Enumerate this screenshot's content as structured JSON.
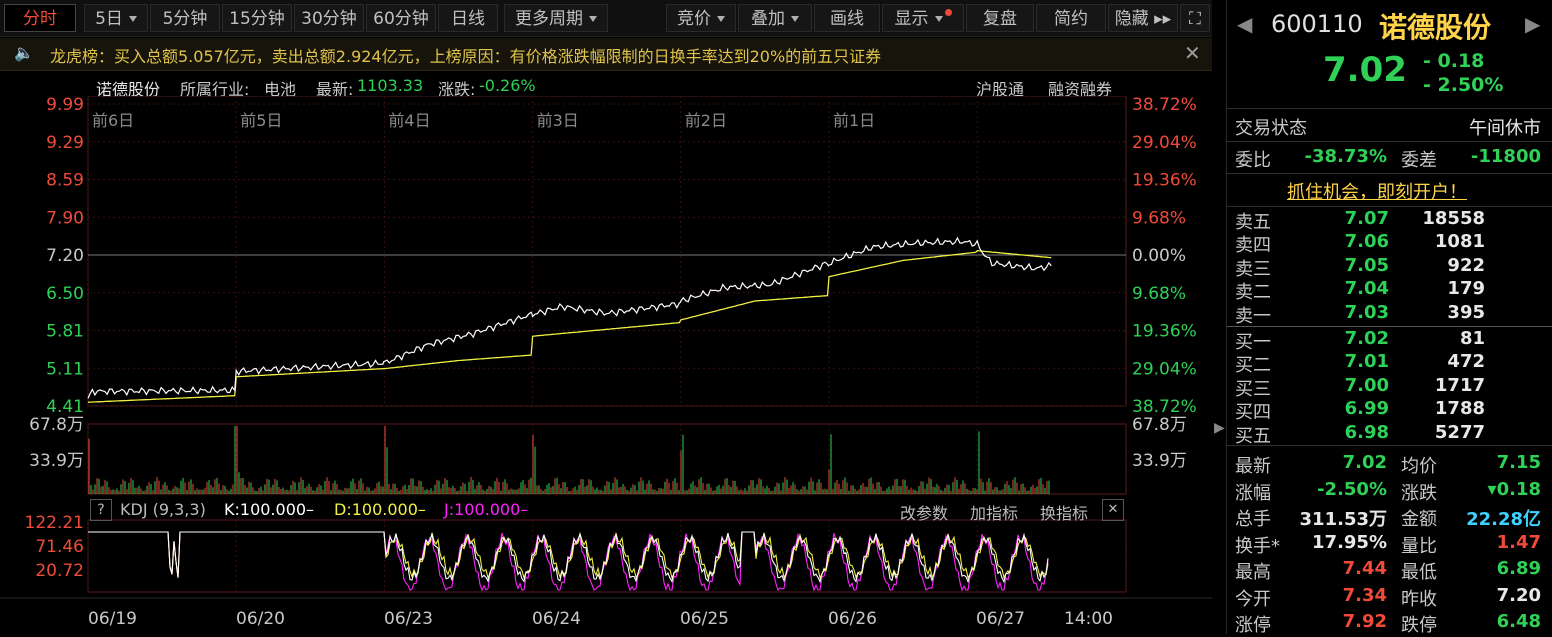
{
  "tabs": [
    {
      "label": "分时",
      "active": true,
      "dropdown": false
    },
    {
      "label": "5日",
      "active": false,
      "dropdown": true
    },
    {
      "label": "5分钟",
      "active": false,
      "dropdown": false
    },
    {
      "label": "15分钟",
      "active": false,
      "dropdown": false
    },
    {
      "label": "30分钟",
      "active": false,
      "dropdown": false
    },
    {
      "label": "60分钟",
      "active": false,
      "dropdown": false
    },
    {
      "label": "日线",
      "active": false,
      "dropdown": false
    },
    {
      "label": "更多周期",
      "active": false,
      "dropdown": true
    }
  ],
  "tools": [
    {
      "label": "竞价",
      "dropdown": true,
      "dot": false
    },
    {
      "label": "叠加",
      "dropdown": true,
      "dot": false
    },
    {
      "label": "画线",
      "dropdown": false,
      "dot": false
    },
    {
      "label": "显示",
      "dropdown": true,
      "dot": true
    },
    {
      "label": "复盘",
      "dropdown": false,
      "dot": false
    },
    {
      "label": "简约",
      "dropdown": false,
      "dot": false
    },
    {
      "label": "隐藏 ▸▸",
      "dropdown": false,
      "dot": false
    }
  ],
  "notice": {
    "text": "龙虎榜：买入总额5.057亿元，卖出总额2.924亿元，上榜原因：有价格涨跌幅限制的日换手率达到20%的前五只证券",
    "close": "✕"
  },
  "info": {
    "name": "诺德股份",
    "industry_label": "所属行业:",
    "industry": "电池",
    "latest_label": "最新:",
    "latest": "1103.33",
    "change_label": "涨跌:",
    "change": "-0.26%",
    "hk_connect": "沪股通",
    "margin": "融资融券"
  },
  "stock": {
    "code": "600110",
    "name": "诺德股份",
    "price": "7.02",
    "change": "- 0.18",
    "change_pct": "- 2.50%"
  },
  "status": {
    "label": "交易状态",
    "value": "午间休市"
  },
  "ratio": {
    "wb_label": "委比",
    "wb": "-38.73%",
    "wc_label": "委差",
    "wc": "-11800"
  },
  "promo": "抓住机会，即刻开户！",
  "asks": [
    {
      "label": "卖五",
      "price": "7.07",
      "vol": "18558"
    },
    {
      "label": "卖四",
      "price": "7.06",
      "vol": "1081"
    },
    {
      "label": "卖三",
      "price": "7.05",
      "vol": "922"
    },
    {
      "label": "卖二",
      "price": "7.04",
      "vol": "179"
    },
    {
      "label": "卖一",
      "price": "7.03",
      "vol": "395"
    }
  ],
  "bids": [
    {
      "label": "买一",
      "price": "7.02",
      "vol": "81"
    },
    {
      "label": "买二",
      "price": "7.01",
      "vol": "472"
    },
    {
      "label": "买三",
      "price": "7.00",
      "vol": "1717"
    },
    {
      "label": "买四",
      "price": "6.99",
      "vol": "1788"
    },
    {
      "label": "买五",
      "price": "6.98",
      "vol": "5277"
    }
  ],
  "stats": [
    {
      "l1": "最新",
      "v1": "7.02",
      "c1": "#2fd156",
      "l2": "均价",
      "v2": "7.15",
      "c2": "#2fd156"
    },
    {
      "l1": "涨幅",
      "v1": "-2.50%",
      "c1": "#2fd156",
      "l2": "涨跌",
      "v2": "▾0.18",
      "c2": "#2fd156"
    },
    {
      "l1": "总手",
      "v1": "311.53万",
      "c1": "#e8e8e8",
      "l2": "金额",
      "v2": "22.28亿",
      "c2": "#3fd2ff"
    },
    {
      "l1": "换手*",
      "v1": "17.95%",
      "c1": "#e8e8e8",
      "l2": "量比",
      "v2": "1.47",
      "c2": "#f04a3a"
    },
    {
      "l1": "最高",
      "v1": "7.44",
      "c1": "#f04a3a",
      "l2": "最低",
      "v2": "6.89",
      "c2": "#2fd156"
    },
    {
      "l1": "今开",
      "v1": "7.34",
      "c1": "#f04a3a",
      "l2": "昨收",
      "v2": "7.20",
      "c2": "#e8e8e8"
    },
    {
      "l1": "涨停",
      "v1": "7.92",
      "c1": "#f04a3a",
      "l2": "跌停",
      "v2": "6.48",
      "c2": "#2fd156"
    }
  ],
  "kdj": {
    "q": "?",
    "name": "KDJ (9,3,3)",
    "k": "K:100.000–",
    "d": "D:100.000–",
    "j": "J:100.000–",
    "modify": "改参数",
    "add": "加指标",
    "switch": "换指标",
    "close": "✕"
  },
  "chart_data": {
    "type": "line",
    "days": [
      "前6日",
      "前5日",
      "前4日",
      "前3日",
      "前2日",
      "前1日"
    ],
    "date_labels": [
      "06/19",
      "06/20",
      "06/23",
      "06/24",
      "06/25",
      "06/26",
      "06/27",
      "14:00"
    ],
    "price_ticks": [
      "9.99",
      "9.29",
      "8.59",
      "7.90",
      "7.20",
      "6.50",
      "5.81",
      "5.11",
      "4.41"
    ],
    "pct_ticks": [
      "38.72%",
      "29.04%",
      "19.36%",
      "9.68%",
      "0.00%",
      "9.68%",
      "19.36%",
      "29.04%",
      "38.72%"
    ],
    "price_range": [
      4.41,
      9.99
    ],
    "prev_close": 7.2,
    "volume_ticks": [
      "67.8万",
      "33.9万"
    ],
    "volume_max": 67.8,
    "kdj_ticks": [
      "122.21",
      "71.46",
      "20.72"
    ],
    "kdj_range": [
      -30,
      122.21
    ],
    "series": [
      {
        "values": [
          [
            0,
            4.55
          ],
          [
            0.03,
            4.68
          ],
          [
            0.99,
            4.7
          ],
          [
            1.0,
            5.05
          ],
          [
            1.99,
            5.2
          ],
          [
            2.0,
            5.2
          ],
          [
            2.3,
            5.55
          ],
          [
            2.6,
            5.75
          ],
          [
            2.99,
            6.1
          ],
          [
            3.0,
            6.1
          ],
          [
            3.2,
            6.25
          ],
          [
            3.5,
            6.12
          ],
          [
            3.99,
            6.3
          ],
          [
            4.0,
            6.35
          ],
          [
            4.3,
            6.6
          ],
          [
            4.6,
            6.65
          ],
          [
            4.99,
            7.05
          ],
          [
            5.0,
            7.05
          ],
          [
            5.3,
            7.35
          ],
          [
            5.6,
            7.42
          ],
          [
            5.9,
            7.45
          ],
          [
            6.0,
            7.4
          ],
          [
            6.05,
            7.2
          ],
          [
            6.1,
            7.05
          ],
          [
            6.4,
            6.95
          ],
          [
            6.5,
            7.0
          ]
        ]
      },
      {
        "values": [
          [
            0,
            4.48
          ],
          [
            0.99,
            4.6
          ],
          [
            1.0,
            4.95
          ],
          [
            1.99,
            5.1
          ],
          [
            2.0,
            5.1
          ],
          [
            2.5,
            5.25
          ],
          [
            2.99,
            5.35
          ],
          [
            3.0,
            5.7
          ],
          [
            3.99,
            5.95
          ],
          [
            4.0,
            6.0
          ],
          [
            4.5,
            6.35
          ],
          [
            4.99,
            6.45
          ],
          [
            5.0,
            6.8
          ],
          [
            5.5,
            7.1
          ],
          [
            5.99,
            7.25
          ],
          [
            6.0,
            7.28
          ],
          [
            6.5,
            7.15
          ]
        ]
      }
    ]
  },
  "colors": {
    "up": "#f04a3a",
    "down": "#2fd156",
    "price_line": "#ffffff",
    "avg_line": "#f0f040",
    "k": "#ffffff",
    "d": "#f0f040",
    "j": "#ff22ff",
    "grid": "#3a1010"
  }
}
